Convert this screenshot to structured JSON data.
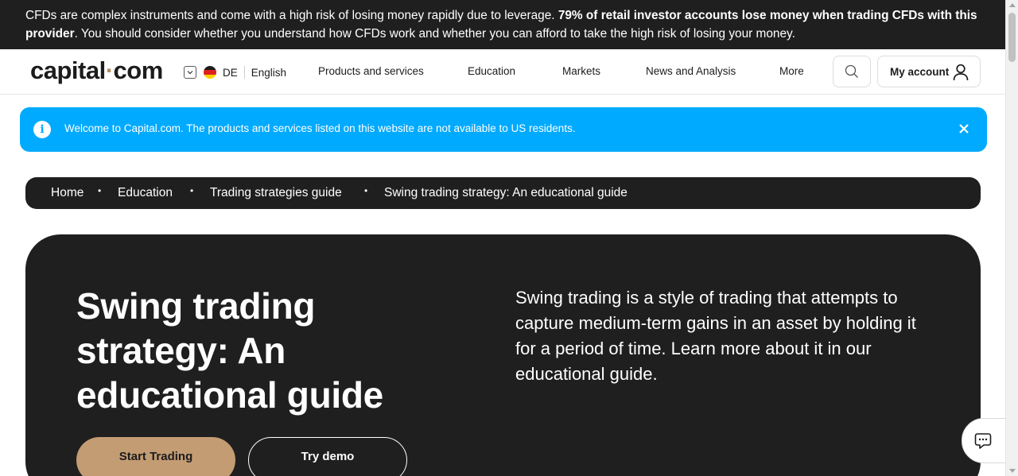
{
  "risk_warning": {
    "text_start": "CFDs are complex instruments and come with a high risk of losing money rapidly due to leverage. ",
    "text_bold": "79% of retail investor accounts lose money when trading CFDs with this provider",
    "text_end": ". You should consider whether you understand how CFDs work and whether you can afford to take the high risk of losing your money."
  },
  "header": {
    "logo_left": "capital",
    "logo_dot": "·",
    "logo_right": "com",
    "country_code": "DE",
    "language": "English",
    "nav": [
      "Products and services",
      "Education",
      "Markets",
      "News and Analysis",
      "More"
    ],
    "account_label": "My account"
  },
  "notice": {
    "text": "Welcome to Capital.com. The products and services listed on this website are not available to US residents."
  },
  "breadcrumb": [
    "Home",
    "Education",
    "Trading strategies guide",
    "Swing trading strategy: An educational guide"
  ],
  "breadcrumb_separator": "•",
  "hero": {
    "title": "Swing trading strategy: An educational guide",
    "description": "Swing trading is a style of trading that attempts to capture medium-term gains in an asset by holding it for a period of time. Learn more about it in our educational guide.",
    "start_button": "Start Trading",
    "demo_button": "Try demo"
  },
  "colors": {
    "dark": "#1f1f1f",
    "accent_gold": "#c39c73",
    "notice_blue": "#00aaff"
  }
}
